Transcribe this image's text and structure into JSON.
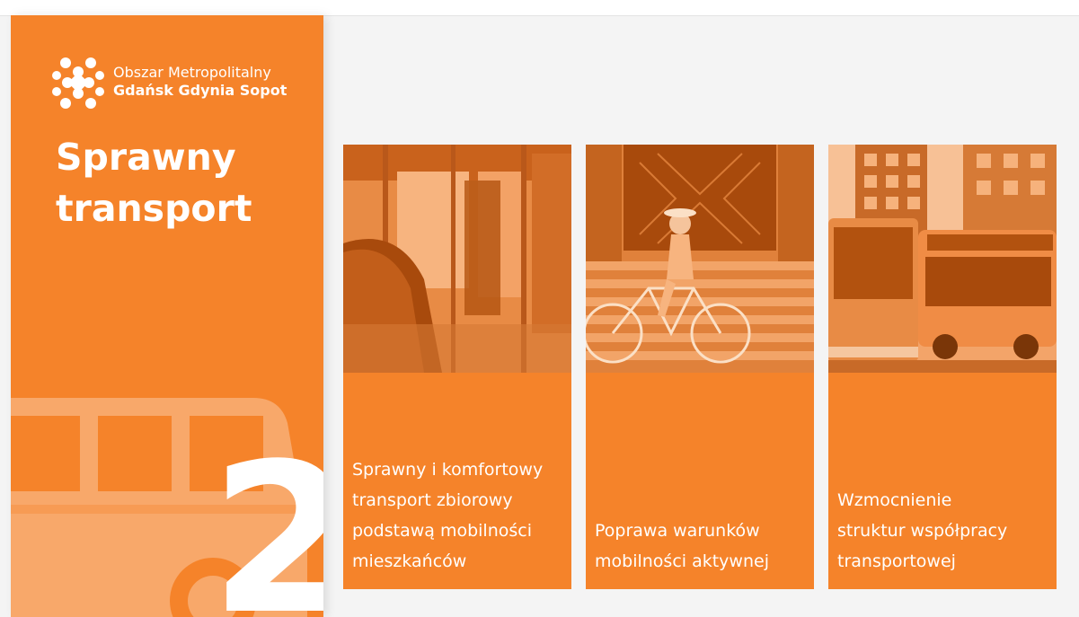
{
  "logo": {
    "line1": "Obszar Metropolitalny",
    "line2": "Gdańsk Gdynia Sopot",
    "icon": "metropolitan-area-logo-icon"
  },
  "sidebar": {
    "title_lines": [
      "Sprawny",
      "transport"
    ],
    "number": "2",
    "graphic": "bus-icon"
  },
  "cards": [
    {
      "image": "bus-interior-photo",
      "lines": [
        "Sprawny i komfortowy",
        "transport zbiorowy",
        "podstawą mobilności",
        "mieszkańców"
      ]
    },
    {
      "image": "cyclist-photo",
      "lines": [
        "Poprawa warunków",
        "mobilności aktywnej"
      ]
    },
    {
      "image": "city-buses-photo",
      "lines": [
        "Wzmocnienie",
        "struktur współpracy",
        "transportowej"
      ]
    }
  ],
  "colors": {
    "brand_orange": "#f5832a",
    "photo_dark": "#b2520f",
    "photo_light": "#f6a768"
  }
}
